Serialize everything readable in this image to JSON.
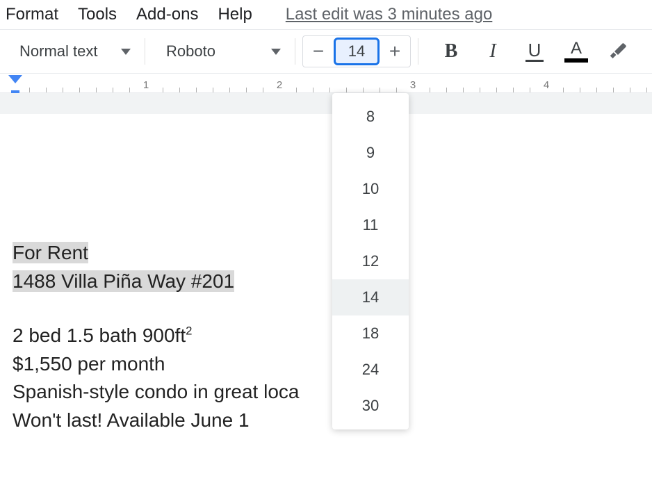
{
  "menubar": {
    "items": [
      "Format",
      "Tools",
      "Add-ons",
      "Help"
    ],
    "last_edit": "Last edit was 3 minutes ago"
  },
  "toolbar": {
    "style_label": "Normal text",
    "font_label": "Roboto",
    "font_size_value": "14",
    "minus": "−",
    "plus": "+",
    "bold": "B",
    "italic": "I",
    "underline": "U",
    "text_color": "A"
  },
  "ruler": {
    "numbers": [
      "1",
      "2",
      "3",
      "4"
    ]
  },
  "font_size_dropdown": {
    "options": [
      "8",
      "9",
      "10",
      "11",
      "12",
      "14",
      "18",
      "24",
      "30"
    ],
    "selected": "14"
  },
  "document": {
    "selected_lines": [
      "For Rent",
      "1488 Villa Piña Way #201"
    ],
    "body_lines": [
      "2 bed 1.5 bath 900ft",
      "$1,550 per month",
      "Spanish-style condo in great loca",
      "Won't last! Available June 1"
    ],
    "superscript": "2"
  }
}
